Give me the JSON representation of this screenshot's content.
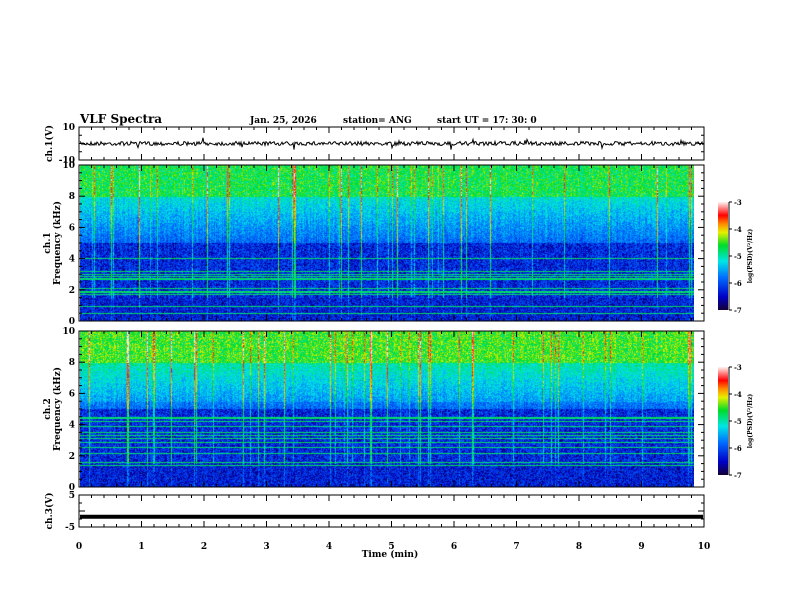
{
  "header": {
    "title": "VLF Spectra",
    "date": "Jan. 25, 2026",
    "station": "station= ANG",
    "start": "start  UT  =   17: 30: 0"
  },
  "chart_data": [
    {
      "type": "line",
      "panel": "ch1-waveform",
      "ylabel": "ch.1(V)",
      "ylim": [
        -10,
        10
      ],
      "yticks": [
        "10",
        "-10"
      ],
      "xlim": [
        0,
        10
      ],
      "baseline": 0,
      "color": "#000000"
    },
    {
      "type": "heatmap",
      "panel": "ch1-spectrogram",
      "ylabel": "ch.1\nFrequency (kHz)",
      "ylabel_lines": [
        "ch.1",
        "Frequency (kHz)"
      ],
      "ylim": [
        0,
        10
      ],
      "yticks": [
        "0",
        "2",
        "4",
        "6",
        "8",
        "10"
      ],
      "xlim": [
        0,
        10
      ],
      "colorbar": {
        "label": "log(PSD)(V²/Hz)",
        "range": [
          -7,
          -3
        ],
        "ticks": [
          "-3",
          "-4",
          "-5",
          "-6",
          "-7"
        ]
      }
    },
    {
      "type": "heatmap",
      "panel": "ch2-spectrogram",
      "ylabel_lines": [
        "ch.2",
        "Frequency (kHz)"
      ],
      "ylim": [
        0,
        10
      ],
      "yticks": [
        "0",
        "2",
        "4",
        "6",
        "8",
        "10"
      ],
      "xlim": [
        0,
        10
      ],
      "colorbar": {
        "label": "log(PSD)(V²/Hz)",
        "range": [
          -7,
          -3
        ],
        "ticks": [
          "-3",
          "-4",
          "-5",
          "-6",
          "-7"
        ]
      }
    },
    {
      "type": "line",
      "panel": "ch3-waveform",
      "ylabel": "ch.3(V)",
      "ylim": [
        -5,
        5
      ],
      "yticks": [
        "5",
        "-5"
      ],
      "xlim": [
        0,
        10
      ],
      "baseline": -1.8,
      "color": "#000000"
    }
  ],
  "xaxis": {
    "label": "Time (min)",
    "ticks": [
      "0",
      "1",
      "2",
      "3",
      "4",
      "5",
      "6",
      "7",
      "8",
      "9",
      "10"
    ]
  }
}
